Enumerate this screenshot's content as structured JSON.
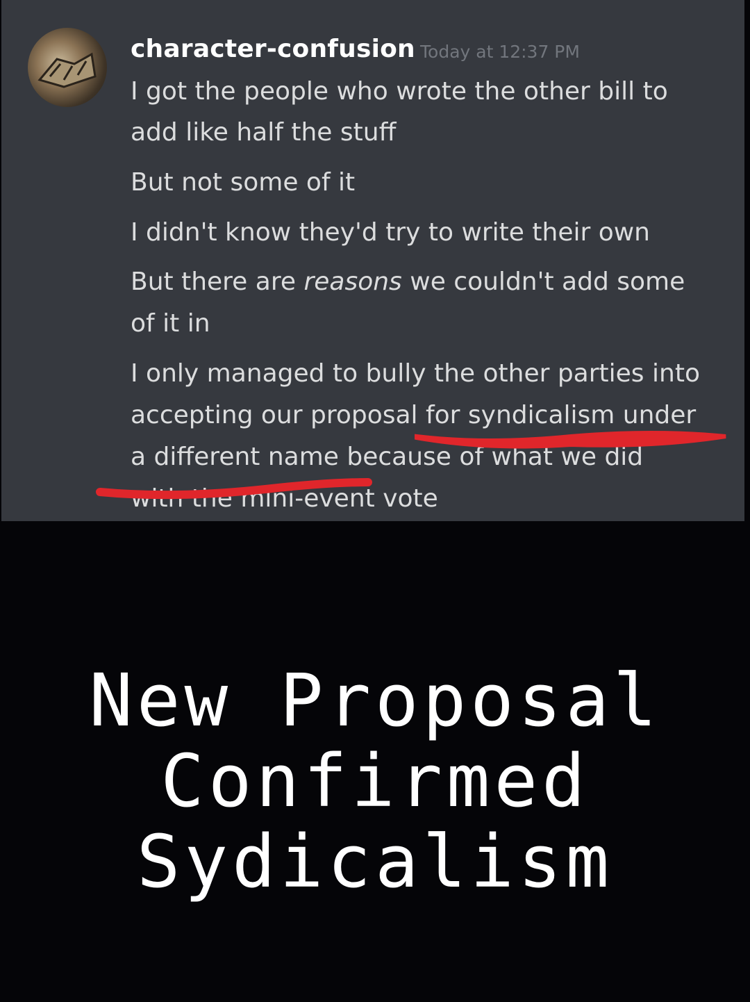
{
  "message": {
    "username": "character-confusion",
    "timestamp": "Today at 12:37 PM",
    "lines": [
      "I got the people who wrote the other bill to",
      "add like half the stuff",
      "But not some of it",
      "I didn't know they'd try to write their own",
      "But there are",
      "reasons",
      "we couldn't add some",
      "of it in",
      "I only managed to bully the other parties into",
      "accepting our proposal for syndicalism under",
      "a different name because of what we did",
      "with the mini-event vote"
    ],
    "annotation_color": "#e0262b"
  },
  "caption": {
    "line1": "New Proposal",
    "line2": "Confirmed",
    "line3": "Sydicalism"
  }
}
